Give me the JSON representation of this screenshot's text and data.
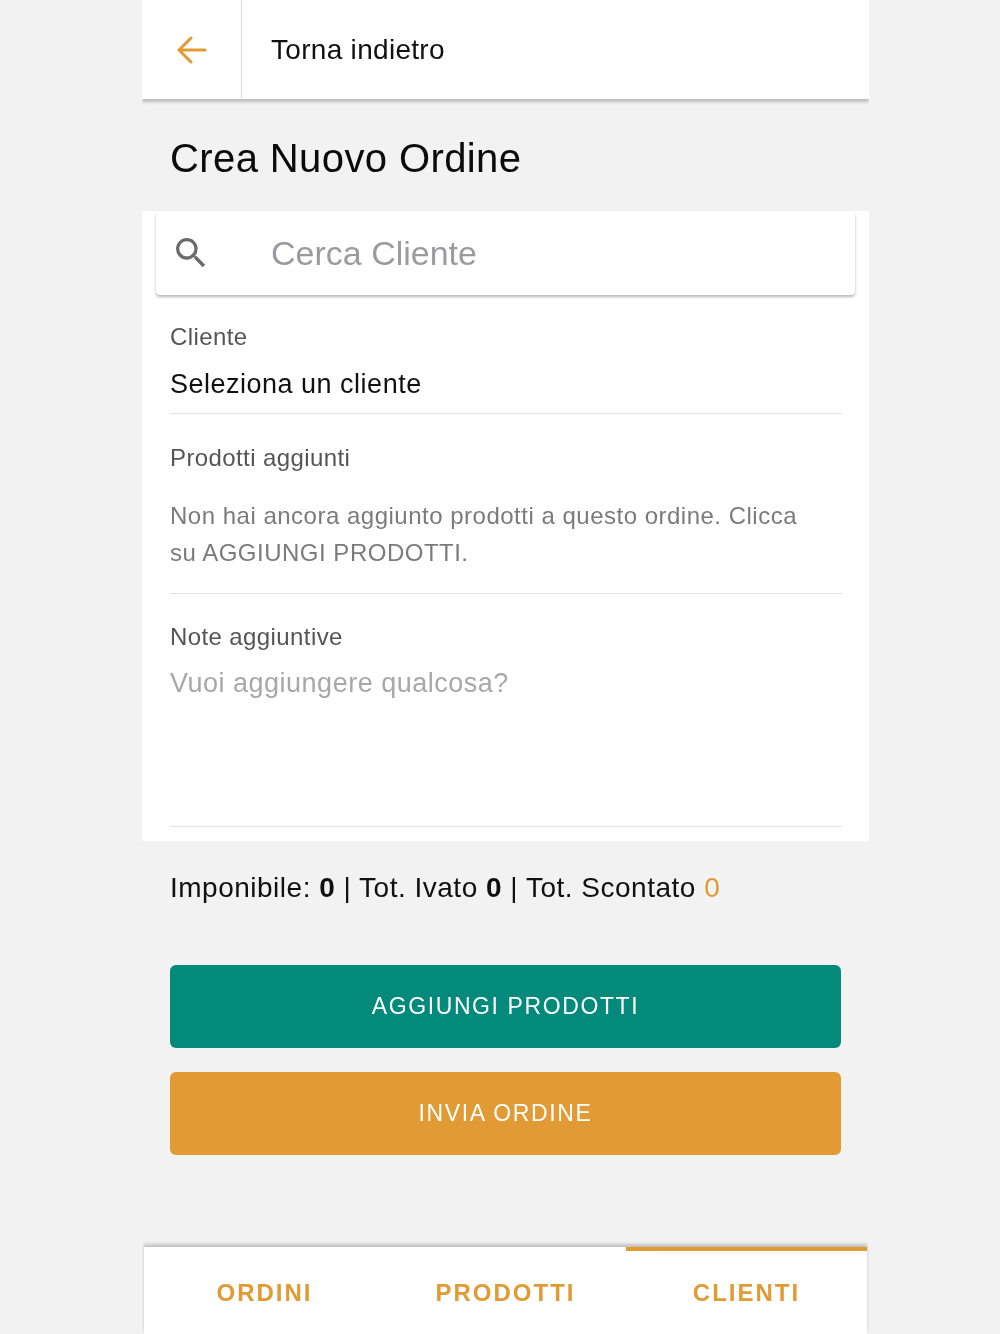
{
  "header": {
    "back_label": "Torna indietro"
  },
  "title": "Crea Nuovo Ordine",
  "search": {
    "placeholder": "Cerca Cliente"
  },
  "client": {
    "label": "Cliente",
    "value": "Seleziona un cliente"
  },
  "products": {
    "label": "Prodotti aggiunti",
    "empty_message": "Non hai ancora aggiunto prodotti a questo ordine. Clicca su AGGIUNGI PRODOTTI."
  },
  "notes": {
    "label": "Note aggiuntive",
    "placeholder": "Vuoi aggiungere qualcosa?"
  },
  "totals": [
    {
      "kind": "amount",
      "label": "Imponibile:",
      "value": "0"
    },
    {
      "kind": "separator",
      "text": "|"
    },
    {
      "kind": "amount",
      "label": "Tot. Ivato",
      "value": "0"
    },
    {
      "kind": "separator",
      "text": "|"
    },
    {
      "kind": "discounted",
      "label": "Tot. Scontato",
      "value": "0"
    }
  ],
  "buttons": [
    {
      "label": "AGGIUNGI PRODOTTI",
      "kind": "primary"
    },
    {
      "label": "INVIA ORDINE",
      "kind": "accent"
    }
  ],
  "tabs": [
    {
      "label": "ORDINI",
      "selected": false
    },
    {
      "label": "PRODOTTI",
      "selected": false
    },
    {
      "label": "CLIENTI",
      "selected": true
    }
  ]
}
